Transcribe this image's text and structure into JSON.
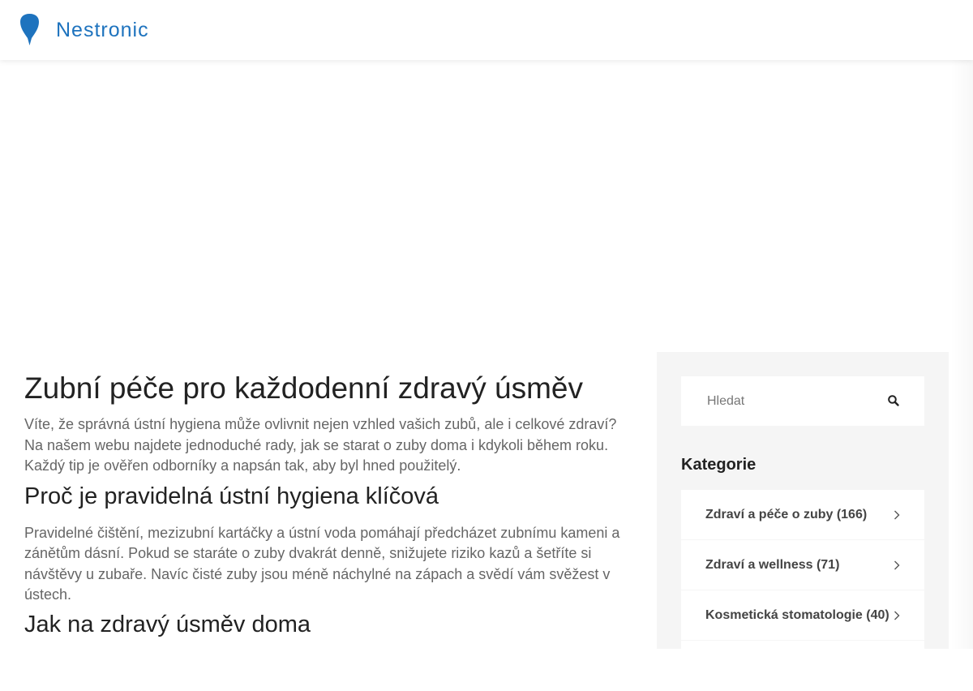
{
  "header": {
    "brand": "Nestronic",
    "logo_icon": "map-pin-icon",
    "accent_color": "#1e73be"
  },
  "article": {
    "title": "Zubní péče pro každodenní zdravý úsměv",
    "intro": "Víte, že správná ústní hygiena může ovlivnit nejen vzhled vašich zubů, ale i celkové zdraví? Na našem webu najdete jednoduché rady, jak se starat o zuby doma i kdykoli během roku. Každý tip je ověřen odborníky a napsán tak, aby byl hned použitelý.",
    "section1_heading": "Proč je pravidelná ústní hygiena klíčová",
    "section1_text": "Pravidelné čištění, mezizubní kartáčky a ústní voda pomáhají předcházet zubnímu kameni a zánětům dásní. Pokud se staráte o zuby dvakrát denně, snižujete riziko kazů a šetříte si návštěvy u zubaře. Navíc čisté zuby jsou méně náchylné na zápach a svědí vám svěžest v ústech.",
    "section2_heading": "Jak na zdravý úsměv doma"
  },
  "sidebar": {
    "search": {
      "placeholder": "Hledat",
      "icon": "search-icon"
    },
    "categories_title": "Kategorie",
    "categories": [
      {
        "label": "Zdraví a péče o zuby (166)",
        "icon": "chevron-right-icon"
      },
      {
        "label": "Zdraví a wellness (71)",
        "icon": "chevron-right-icon"
      },
      {
        "label": "Kosmetická stomatologie (40)",
        "icon": "chevron-right-icon"
      }
    ]
  }
}
